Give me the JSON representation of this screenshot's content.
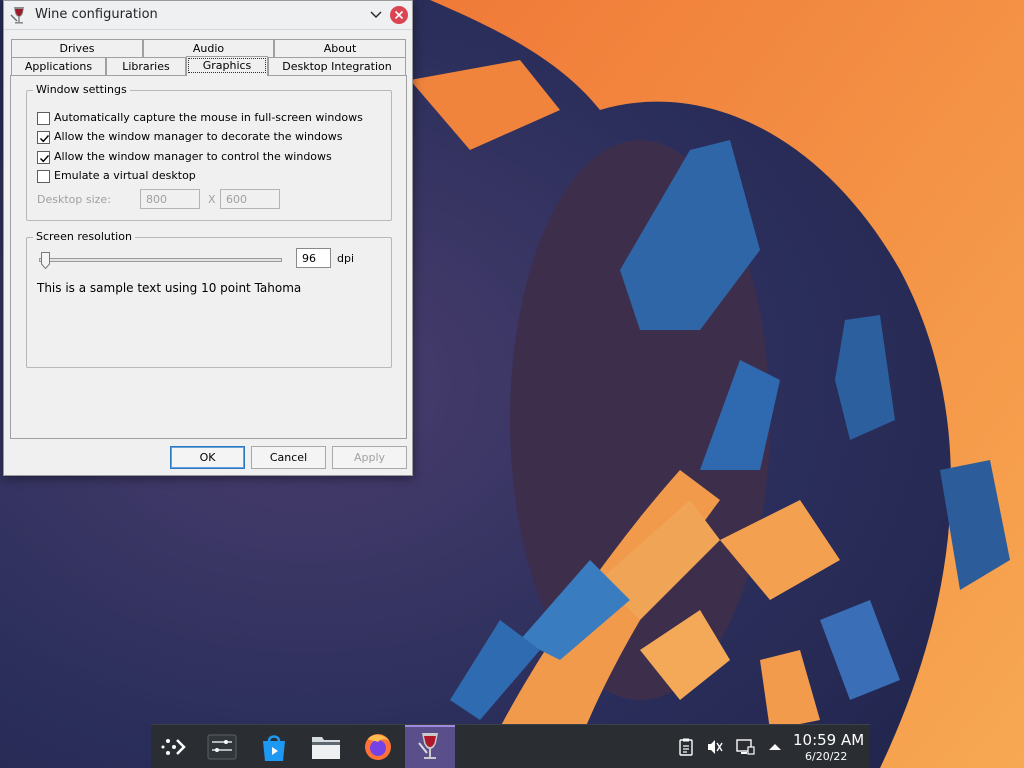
{
  "window": {
    "title": "Wine configuration",
    "icon": "wine-glass-icon"
  },
  "tabs_row1": [
    {
      "label": "Drives"
    },
    {
      "label": "Audio"
    },
    {
      "label": "About"
    }
  ],
  "tabs_row2": [
    {
      "label": "Applications"
    },
    {
      "label": "Libraries"
    },
    {
      "label": "Graphics",
      "active": true
    },
    {
      "label": "Desktop Integration"
    }
  ],
  "window_settings": {
    "title": "Window settings",
    "options": [
      {
        "label": "Automatically capture the mouse in full-screen windows",
        "checked": false
      },
      {
        "label": "Allow the window manager to decorate the windows",
        "checked": true
      },
      {
        "label": "Allow the window manager to control the windows",
        "checked": true
      },
      {
        "label": "Emulate a virtual desktop",
        "checked": false
      }
    ],
    "desktop_size_label": "Desktop size:",
    "width": "800",
    "separator": "X",
    "height": "600"
  },
  "screen_resolution": {
    "title": "Screen resolution",
    "dpi": "96",
    "dpi_unit": "dpi",
    "slider_value": 96,
    "sample_text": "This is a sample text using 10 point Tahoma"
  },
  "buttons": {
    "ok": "OK",
    "cancel": "Cancel",
    "apply": "Apply"
  },
  "taskbar": {
    "apps": [
      "application-launcher-icon",
      "system-settings-icon",
      "discover-store-icon",
      "dolphin-file-manager-icon",
      "firefox-icon",
      "wine-icon"
    ],
    "tray": [
      "clipboard-icon",
      "volume-muted-icon",
      "network-wired-icon",
      "expand-tray-icon"
    ],
    "time": "10:59 AM",
    "date": "6/20/22"
  },
  "colors": {
    "wallpaper_blue": "#26294f",
    "wallpaper_orange": "#f08a3c",
    "accent": "#2b78c5",
    "close_red": "#da4453"
  }
}
